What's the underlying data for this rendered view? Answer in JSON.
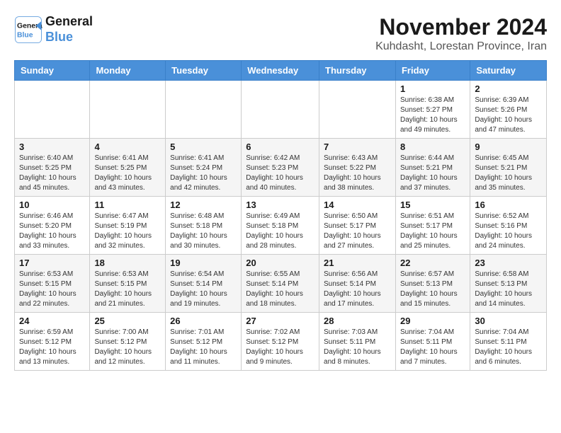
{
  "header": {
    "logo_line1": "General",
    "logo_line2": "Blue",
    "title": "November 2024",
    "subtitle": "Kuhdasht, Lorestan Province, Iran"
  },
  "calendar": {
    "headers": [
      "Sunday",
      "Monday",
      "Tuesday",
      "Wednesday",
      "Thursday",
      "Friday",
      "Saturday"
    ],
    "weeks": [
      [
        {
          "day": "",
          "info": ""
        },
        {
          "day": "",
          "info": ""
        },
        {
          "day": "",
          "info": ""
        },
        {
          "day": "",
          "info": ""
        },
        {
          "day": "",
          "info": ""
        },
        {
          "day": "1",
          "info": "Sunrise: 6:38 AM\nSunset: 5:27 PM\nDaylight: 10 hours\nand 49 minutes."
        },
        {
          "day": "2",
          "info": "Sunrise: 6:39 AM\nSunset: 5:26 PM\nDaylight: 10 hours\nand 47 minutes."
        }
      ],
      [
        {
          "day": "3",
          "info": "Sunrise: 6:40 AM\nSunset: 5:25 PM\nDaylight: 10 hours\nand 45 minutes."
        },
        {
          "day": "4",
          "info": "Sunrise: 6:41 AM\nSunset: 5:25 PM\nDaylight: 10 hours\nand 43 minutes."
        },
        {
          "day": "5",
          "info": "Sunrise: 6:41 AM\nSunset: 5:24 PM\nDaylight: 10 hours\nand 42 minutes."
        },
        {
          "day": "6",
          "info": "Sunrise: 6:42 AM\nSunset: 5:23 PM\nDaylight: 10 hours\nand 40 minutes."
        },
        {
          "day": "7",
          "info": "Sunrise: 6:43 AM\nSunset: 5:22 PM\nDaylight: 10 hours\nand 38 minutes."
        },
        {
          "day": "8",
          "info": "Sunrise: 6:44 AM\nSunset: 5:21 PM\nDaylight: 10 hours\nand 37 minutes."
        },
        {
          "day": "9",
          "info": "Sunrise: 6:45 AM\nSunset: 5:21 PM\nDaylight: 10 hours\nand 35 minutes."
        }
      ],
      [
        {
          "day": "10",
          "info": "Sunrise: 6:46 AM\nSunset: 5:20 PM\nDaylight: 10 hours\nand 33 minutes."
        },
        {
          "day": "11",
          "info": "Sunrise: 6:47 AM\nSunset: 5:19 PM\nDaylight: 10 hours\nand 32 minutes."
        },
        {
          "day": "12",
          "info": "Sunrise: 6:48 AM\nSunset: 5:18 PM\nDaylight: 10 hours\nand 30 minutes."
        },
        {
          "day": "13",
          "info": "Sunrise: 6:49 AM\nSunset: 5:18 PM\nDaylight: 10 hours\nand 28 minutes."
        },
        {
          "day": "14",
          "info": "Sunrise: 6:50 AM\nSunset: 5:17 PM\nDaylight: 10 hours\nand 27 minutes."
        },
        {
          "day": "15",
          "info": "Sunrise: 6:51 AM\nSunset: 5:17 PM\nDaylight: 10 hours\nand 25 minutes."
        },
        {
          "day": "16",
          "info": "Sunrise: 6:52 AM\nSunset: 5:16 PM\nDaylight: 10 hours\nand 24 minutes."
        }
      ],
      [
        {
          "day": "17",
          "info": "Sunrise: 6:53 AM\nSunset: 5:15 PM\nDaylight: 10 hours\nand 22 minutes."
        },
        {
          "day": "18",
          "info": "Sunrise: 6:53 AM\nSunset: 5:15 PM\nDaylight: 10 hours\nand 21 minutes."
        },
        {
          "day": "19",
          "info": "Sunrise: 6:54 AM\nSunset: 5:14 PM\nDaylight: 10 hours\nand 19 minutes."
        },
        {
          "day": "20",
          "info": "Sunrise: 6:55 AM\nSunset: 5:14 PM\nDaylight: 10 hours\nand 18 minutes."
        },
        {
          "day": "21",
          "info": "Sunrise: 6:56 AM\nSunset: 5:14 PM\nDaylight: 10 hours\nand 17 minutes."
        },
        {
          "day": "22",
          "info": "Sunrise: 6:57 AM\nSunset: 5:13 PM\nDaylight: 10 hours\nand 15 minutes."
        },
        {
          "day": "23",
          "info": "Sunrise: 6:58 AM\nSunset: 5:13 PM\nDaylight: 10 hours\nand 14 minutes."
        }
      ],
      [
        {
          "day": "24",
          "info": "Sunrise: 6:59 AM\nSunset: 5:12 PM\nDaylight: 10 hours\nand 13 minutes."
        },
        {
          "day": "25",
          "info": "Sunrise: 7:00 AM\nSunset: 5:12 PM\nDaylight: 10 hours\nand 12 minutes."
        },
        {
          "day": "26",
          "info": "Sunrise: 7:01 AM\nSunset: 5:12 PM\nDaylight: 10 hours\nand 11 minutes."
        },
        {
          "day": "27",
          "info": "Sunrise: 7:02 AM\nSunset: 5:12 PM\nDaylight: 10 hours\nand 9 minutes."
        },
        {
          "day": "28",
          "info": "Sunrise: 7:03 AM\nSunset: 5:11 PM\nDaylight: 10 hours\nand 8 minutes."
        },
        {
          "day": "29",
          "info": "Sunrise: 7:04 AM\nSunset: 5:11 PM\nDaylight: 10 hours\nand 7 minutes."
        },
        {
          "day": "30",
          "info": "Sunrise: 7:04 AM\nSunset: 5:11 PM\nDaylight: 10 hours\nand 6 minutes."
        }
      ]
    ]
  }
}
